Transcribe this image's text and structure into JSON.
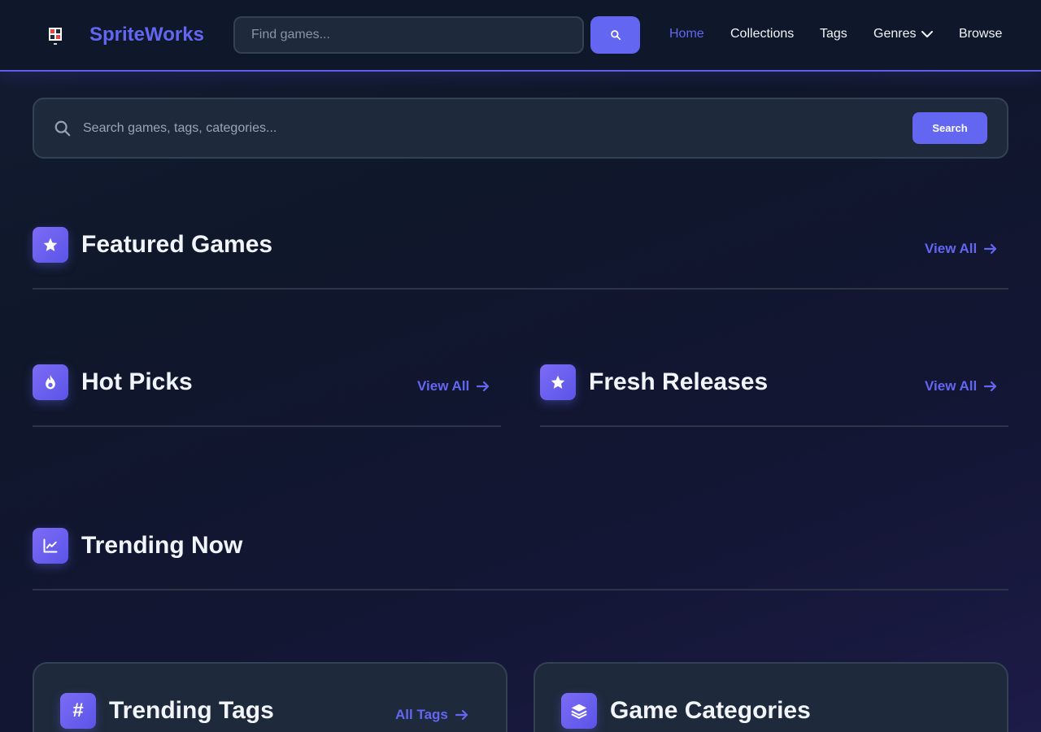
{
  "header": {
    "brand": "SpriteWorks",
    "search_placeholder": "Find games...",
    "nav": [
      {
        "label": "Home",
        "active": true
      },
      {
        "label": "Collections"
      },
      {
        "label": "Tags"
      },
      {
        "label": "Genres"
      },
      {
        "label": "Browse"
      }
    ]
  },
  "search": {
    "placeholder": "Search games, tags, categories...",
    "button_label": "Search"
  },
  "sections": {
    "featured": {
      "title": "Featured Games",
      "view_all": "View All",
      "icon": "star-icon"
    },
    "hot_picks": {
      "title": "Hot Picks",
      "view_all": "View All",
      "icon": "fire-icon"
    },
    "fresh_releases": {
      "title": "Fresh Releases",
      "view_all": "View All",
      "icon": "star-icon"
    },
    "trending_now": {
      "title": "Trending Now",
      "icon": "chart-line-icon"
    }
  },
  "cards": {
    "trending_tags": {
      "title": "Trending Tags",
      "link": "All Tags",
      "icon": "hashtag-icon"
    },
    "game_categories": {
      "title": "Game Categories",
      "icon": "layers-icon"
    }
  },
  "colors": {
    "accent": "#6366f1",
    "background": "#0f172a",
    "surface": "#1e293b",
    "border": "#334155"
  }
}
